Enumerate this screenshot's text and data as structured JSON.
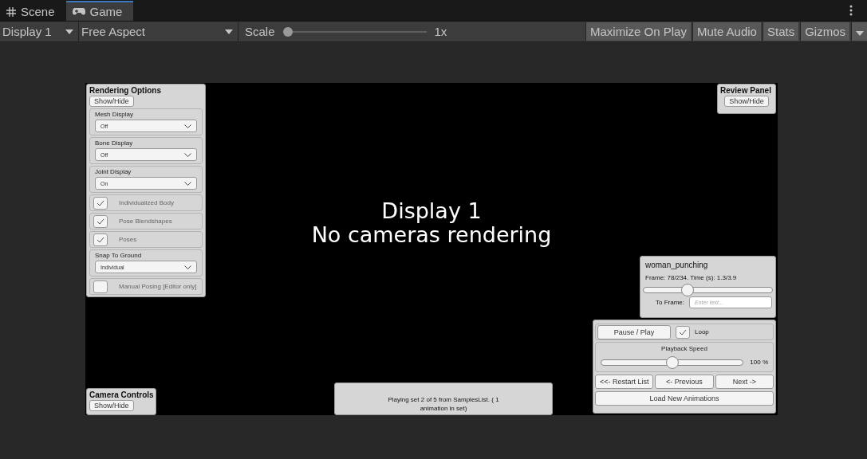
{
  "tabs": [
    {
      "label": "Scene",
      "kind": "scene",
      "selected": false
    },
    {
      "label": "Game",
      "kind": "game",
      "selected": true
    }
  ],
  "toolbar": {
    "display": "Display 1",
    "aspect": "Free Aspect",
    "scale": {
      "label": "Scale",
      "level": 0.0,
      "value": "1x"
    },
    "toggles": [
      {
        "label": "Maximize On Play",
        "on": false
      },
      {
        "label": "Mute Audio",
        "on": false
      },
      {
        "label": "Stats",
        "on": false
      },
      {
        "label": "Gizmos",
        "on": false
      }
    ]
  },
  "viewport": {
    "message_lines": [
      "Display 1",
      "No cameras rendering"
    ]
  },
  "rendering_options": {
    "title": "Rendering Options",
    "button": "Show/Hide",
    "items": [
      {
        "kind": "dropdown",
        "label": "Mesh Display",
        "value": "Off"
      },
      {
        "kind": "dropdown",
        "label": "Bone Display",
        "value": "Off"
      },
      {
        "kind": "dropdown",
        "label": "Joint Display",
        "value": "On"
      },
      {
        "kind": "checkbox",
        "label": "Individualized Body",
        "checked": true
      },
      {
        "kind": "checkbox",
        "label": "Pose Blendshapes",
        "checked": true
      },
      {
        "kind": "checkbox",
        "label": "Poses",
        "checked": true
      },
      {
        "kind": "dropdown",
        "label": "Snap To Ground",
        "value": "Individual"
      },
      {
        "kind": "checkbox",
        "label": "Manual Posing [Editor only]",
        "checked": false
      }
    ]
  },
  "review_panel": {
    "title": "Review Panel",
    "button": "Show/Hide"
  },
  "clip_panel": {
    "name": "woman_punching",
    "frame_info": "Frame: 78/234. Time (s): 1.3/3.9",
    "level": 0.34,
    "to_frame_label": "To Frame:",
    "placeholder": "Enter text..."
  },
  "playback": {
    "pause_play": "Pause / Play",
    "loop_label": "Loop",
    "loop_checked": true,
    "speed": {
      "label": "Playback Speed",
      "level": 0.5,
      "value": "100 %"
    },
    "nav_buttons": [
      "<<- Restart List",
      "<- Previous",
      "Next ->"
    ],
    "load_button": "Load New Animations"
  },
  "camera_controls": {
    "title": "Camera Controls",
    "button": "Show/Hide"
  },
  "status": {
    "text": "Playing set 2 of 5 from SamplesList. ( 1 animation in set)"
  }
}
